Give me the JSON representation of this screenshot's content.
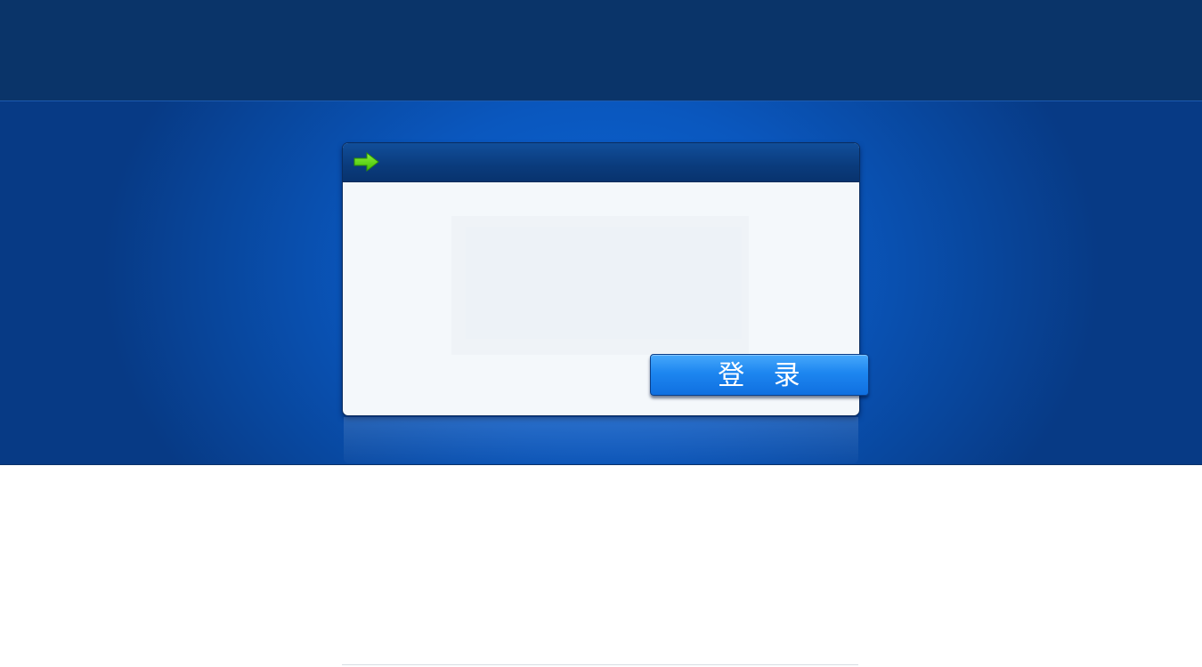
{
  "panel": {
    "title": "",
    "header_icon": "green-right-arrow-icon"
  },
  "actions": {
    "login_label": "登　录"
  },
  "colors": {
    "top_band": "#0a3469",
    "mid_band": "#0a57be",
    "panel_background": "#f4f8fb",
    "button_blue": "#1d86f0",
    "arrow_green": "#5bd40e"
  }
}
